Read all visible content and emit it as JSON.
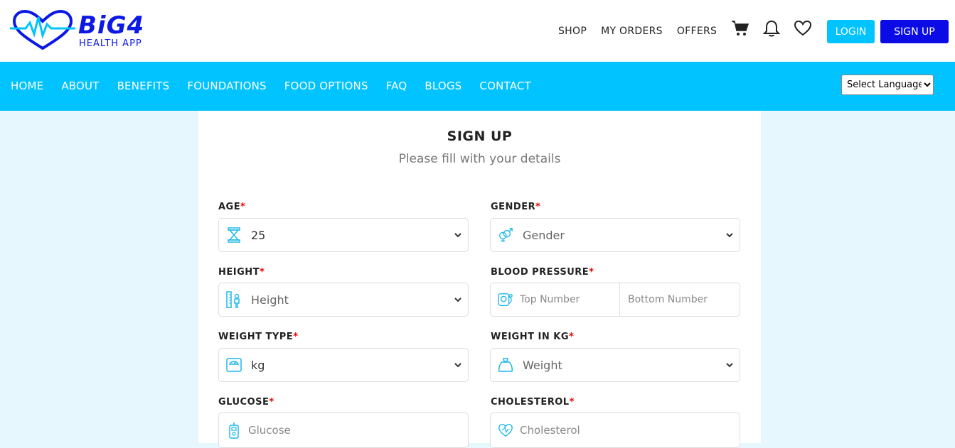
{
  "brand": {
    "name": "BiG4",
    "tagline": "HEALTH APP"
  },
  "topnav": {
    "links": [
      "SHOP",
      "MY ORDERS",
      "OFFERS"
    ],
    "login": "LOGIN",
    "signup": "SIGN UP"
  },
  "mainnav": {
    "items": [
      "HOME",
      "ABOUT",
      "BENEFITS",
      "FOUNDATIONS",
      "FOOD OPTIONS",
      "FAQ",
      "BLOGS",
      "CONTACT"
    ],
    "language": "Select Language"
  },
  "form": {
    "title": "SIGN UP",
    "subtitle": "Please fill with your details",
    "required_mark": "*",
    "age": {
      "label": "AGE",
      "value": "25"
    },
    "gender": {
      "label": "GENDER",
      "value": "Gender"
    },
    "height": {
      "label": "HEIGHT",
      "value": "Height"
    },
    "blood_pressure": {
      "label": "BLOOD PRESSURE",
      "top_placeholder": "Top Number",
      "bottom_placeholder": "Bottom Number"
    },
    "weight_type": {
      "label": "WEIGHT TYPE",
      "value": "kg"
    },
    "weight": {
      "label": "WEIGHT IN KG",
      "value": "Weight"
    },
    "glucose": {
      "label": "GLUCOSE",
      "placeholder": "Glucose"
    },
    "cholesterol": {
      "label": "CHOLESTEROL",
      "placeholder": "Cholesterol"
    }
  },
  "colors": {
    "accent": "#00c3ff",
    "brand": "#0b0be6",
    "required": "#ee0000",
    "page_bg": "#e6f8fd"
  }
}
